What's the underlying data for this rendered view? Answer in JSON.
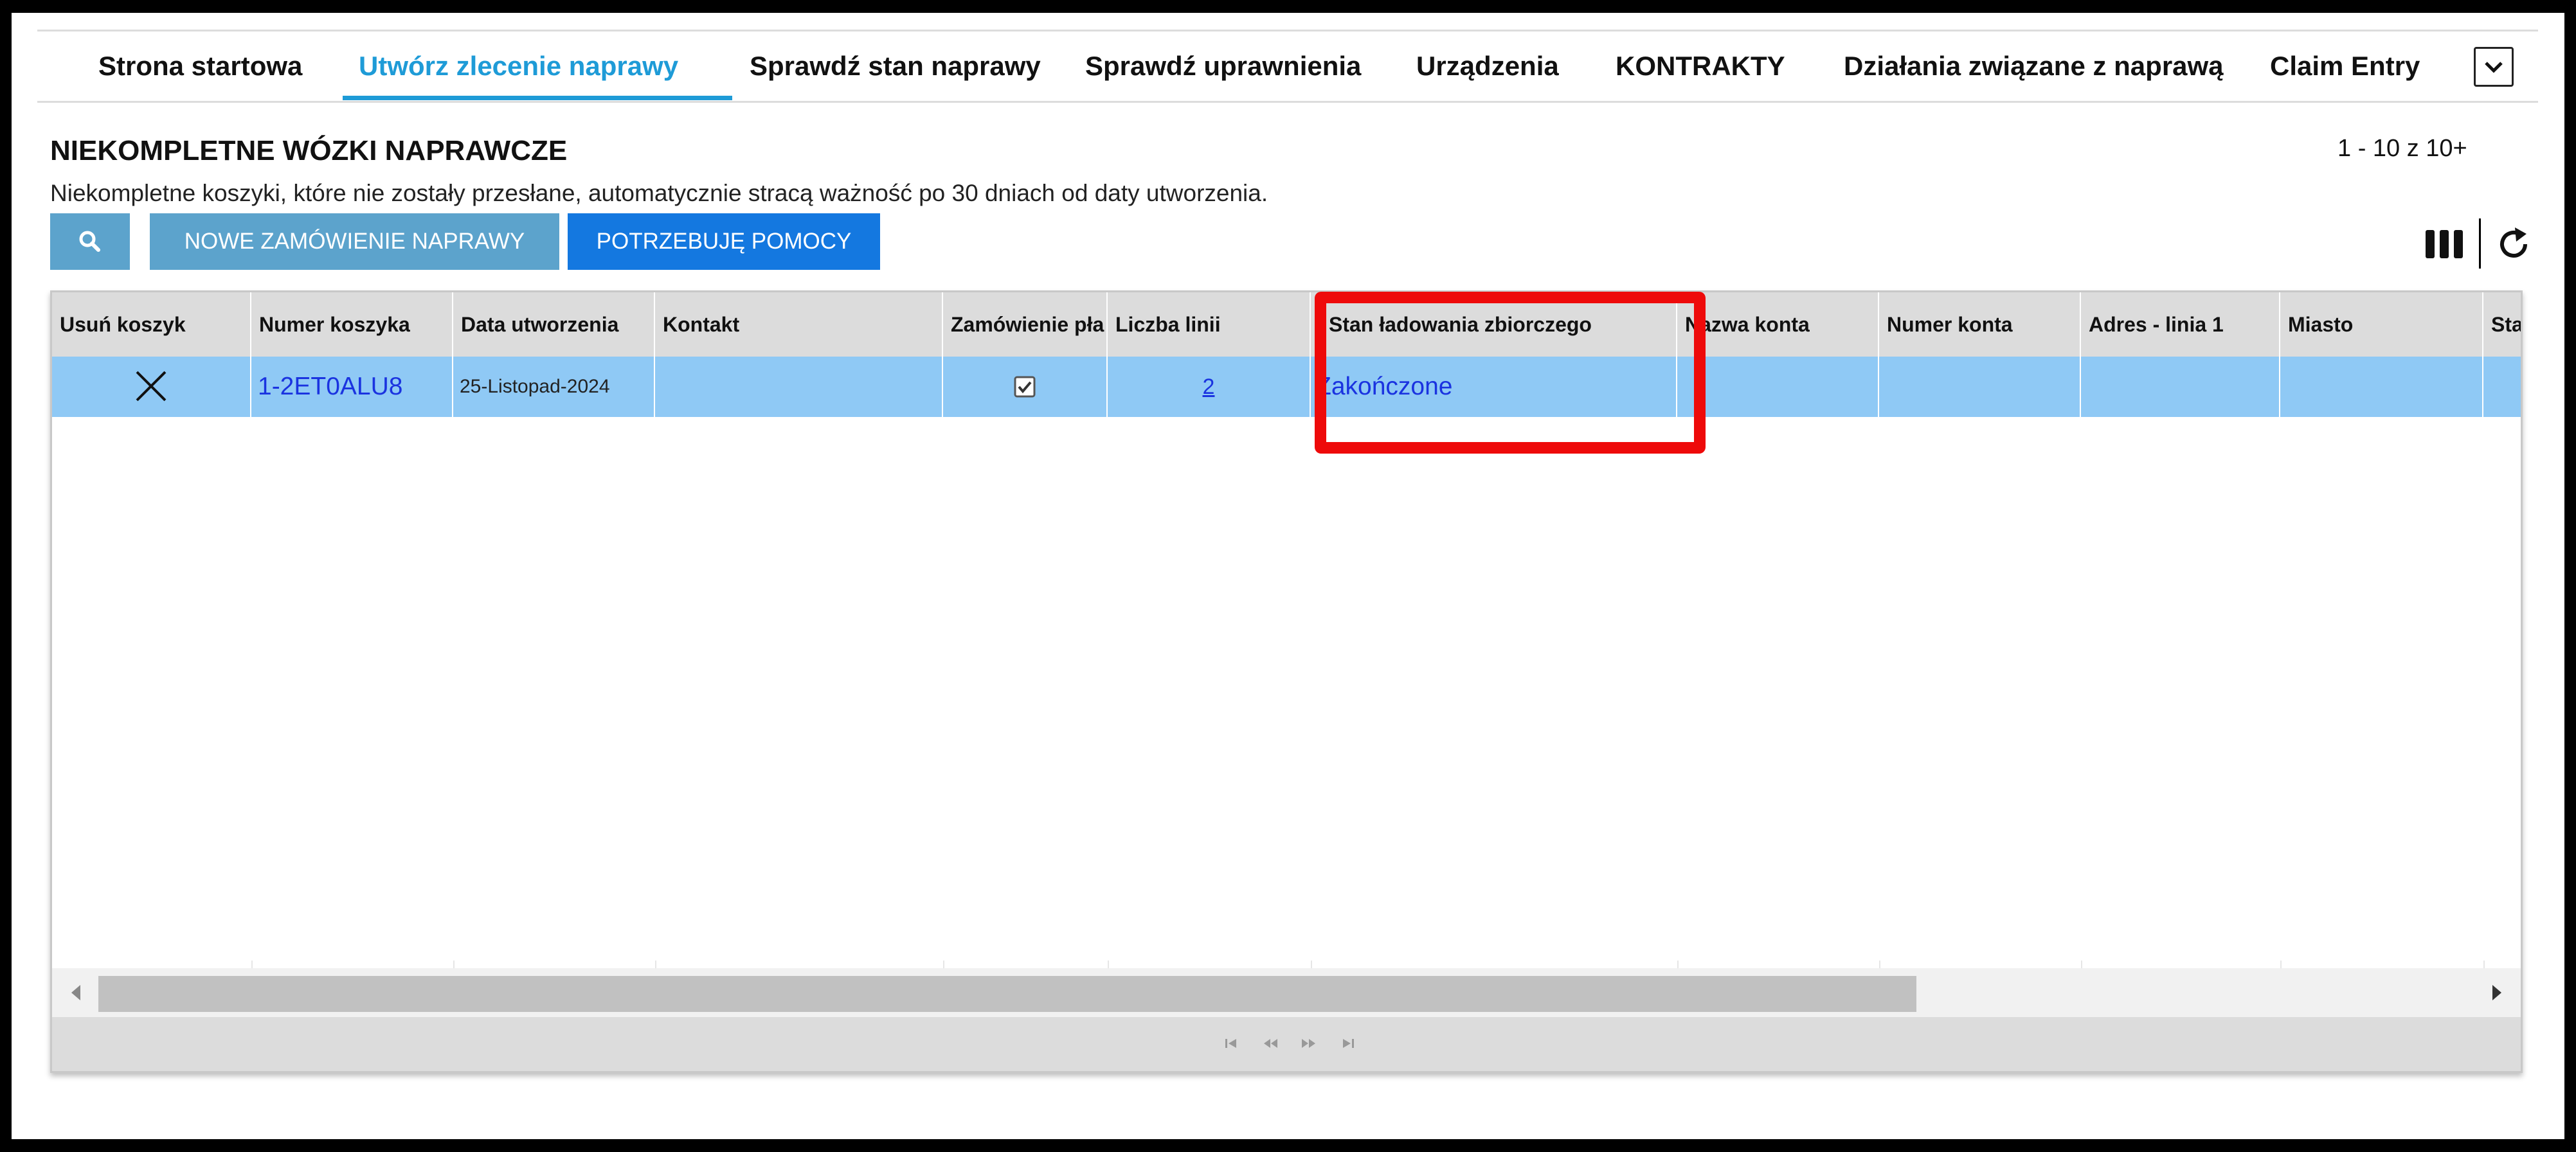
{
  "nav": {
    "tabs": [
      {
        "label": "Strona startowa"
      },
      {
        "label": "Utwórz zlecenie naprawy"
      },
      {
        "label": "Sprawdź stan naprawy"
      },
      {
        "label": "Sprawdź uprawnienia"
      },
      {
        "label": "Urządzenia"
      },
      {
        "label": "KONTRAKTY"
      },
      {
        "label": "Działania związane z naprawą"
      },
      {
        "label": "Claim Entry"
      }
    ],
    "active_tab": "Utwórz zlecenie naprawy",
    "more_icon": "chevron-down-icon"
  },
  "header": {
    "title": "NIEKOMPLETNE WÓZKI NAPRAWCZE",
    "pager": "1 - 10 z 10+",
    "notice": "Niekompletne koszyki, które nie zostały przesłane, automatycznie stracą ważność po 30 dniach od daty utworzenia."
  },
  "toolbar": {
    "search_icon": "search-icon",
    "new_order_label": "NOWE ZAMÓWIENIE NAPRAWY",
    "help_label": "POTRZEBUJĘ POMOCY",
    "columns_icon": "columns-icon",
    "refresh_icon": "refresh-icon"
  },
  "grid": {
    "columns": [
      "Usuń koszyk",
      "Numer koszyka",
      "Data utworzenia",
      "Kontakt",
      "Zamówienie pła",
      "Liczba linii",
      "Stan ładowania zbiorczego",
      "Nazwa konta",
      "Numer konta",
      "Adres - linia 1",
      "Miasto",
      "Sta"
    ],
    "rows": [
      {
        "delete_icon": "close-icon",
        "cart_number": "1-2ET0ALU8",
        "created_date": "25-Listopad-2024",
        "contact": "",
        "paid_order_checked": true,
        "line_count": "2",
        "bulk_load_status": "Zakończone",
        "account_name": "",
        "account_number": "",
        "address_line1": "",
        "city": "",
        "state": ""
      }
    ]
  },
  "footer": {
    "icons": [
      "first-page-icon",
      "prev-page-icon",
      "next-page-icon",
      "last-page-icon"
    ]
  },
  "colors": {
    "accent": "#1e9bd7",
    "selected_row": "#8fc9f5",
    "highlight": "#ee0a0a",
    "primary_button": "#1478e0",
    "secondary_button": "#5ca3cc"
  }
}
